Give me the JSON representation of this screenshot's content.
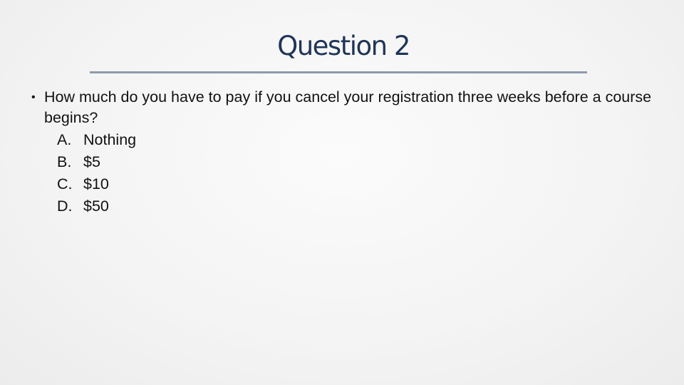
{
  "slide": {
    "title": "Question 2",
    "question": {
      "bullet_icon": "•",
      "text": "How much do you have to pay if you cancel your registration three weeks before a course begins?"
    },
    "options": [
      {
        "letter": "A.",
        "text": "Nothing"
      },
      {
        "letter": "B.",
        "text": "$5"
      },
      {
        "letter": "C.",
        "text": "$10"
      },
      {
        "letter": "D.",
        "text": "$50"
      }
    ]
  },
  "colors": {
    "title": "#1f3457",
    "rule": "#8e9aae",
    "body_text": "#111111"
  }
}
